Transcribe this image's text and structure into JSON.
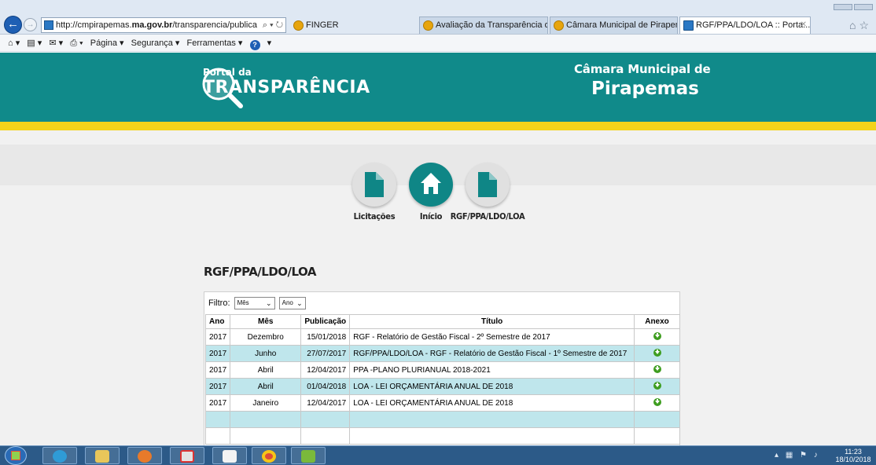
{
  "browser": {
    "url_prefix": "http://cmpirapemas.",
    "url_host": "ma.gov.br",
    "url_path": "/transparencia/publica",
    "url_tools": "⌕ ▾ ↻",
    "tabs": [
      {
        "label": "FINGER"
      },
      {
        "label": "Avaliação da Transparência do..."
      },
      {
        "label": "Câmara Municipal de Pirapem..."
      },
      {
        "label": "RGF/PPA/LDO/LOA :: Porta...",
        "close": "✕"
      }
    ],
    "command_bar": {
      "pagina": "Página ▾",
      "seguranca": "Segurança ▾",
      "ferramentas": "Ferramentas ▾",
      "help": "?"
    }
  },
  "header": {
    "logo_small": "Portal da",
    "logo_big": "TRANSPARÊNCIA",
    "chamber_line1": "Câmara Municipal de",
    "chamber_line2": "Pirapemas"
  },
  "nav": [
    {
      "label": "Licitações",
      "icon": "document-icon"
    },
    {
      "label": "Início",
      "icon": "home-icon"
    },
    {
      "label": "RGF/PPA/LDO/LOA",
      "icon": "document-icon"
    }
  ],
  "section_title": "RGF/PPA/LDO/LOA",
  "filter": {
    "label": "Filtro:",
    "month_value": "Mês",
    "year_value": "Ano"
  },
  "table": {
    "columns": [
      "Ano",
      "Mês",
      "Publicação",
      "Título",
      "Anexo"
    ],
    "rows": [
      {
        "ano": "2017",
        "mes": "Dezembro",
        "publicacao": "15/01/2018",
        "titulo": "RGF - Relatório de Gestão Fiscal - 2º Semestre de 2017"
      },
      {
        "ano": "2017",
        "mes": "Junho",
        "publicacao": "27/07/2017",
        "titulo": "RGF/PPA/LDO/LOA - RGF - Relatório de Gestão Fiscal - 1º Semestre de 2017"
      },
      {
        "ano": "2017",
        "mes": "Abril",
        "publicacao": "12/04/2017",
        "titulo": "PPA -PLANO PLURIANUAL 2018-2021"
      },
      {
        "ano": "2017",
        "mes": "Abril",
        "publicacao": "01/04/2018",
        "titulo": "LOA - LEI ORÇAMENTÁRIA ANUAL DE 2018"
      },
      {
        "ano": "2017",
        "mes": "Janeiro",
        "publicacao": "12/04/2017",
        "titulo": "LOA - LEI ORÇAMENTÁRIA ANUAL DE 2018"
      }
    ]
  },
  "taskbar": {
    "time": "11:23",
    "date": "18/10/2018"
  },
  "colors": {
    "header_teal": "#108a8a",
    "stripe_yellow": "#f3d31a",
    "row_alt": "#bfe6ec",
    "download_green": "#3e9d1f"
  }
}
